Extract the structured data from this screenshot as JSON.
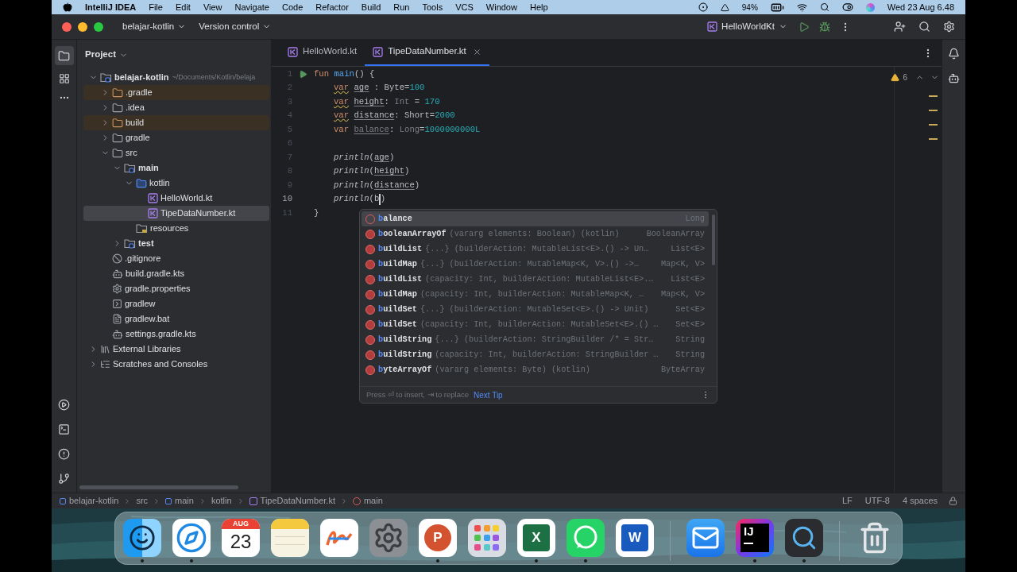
{
  "menubar": {
    "app": "IntelliJ IDEA",
    "menus": [
      "File",
      "Edit",
      "View",
      "Navigate",
      "Code",
      "Refactor",
      "Build",
      "Run",
      "Tools",
      "VCS",
      "Window",
      "Help"
    ],
    "battery": "94%",
    "clock": "Wed 23 Aug 6.48"
  },
  "titlebar": {
    "project": "belajar-kotlin",
    "vcs": "Version control",
    "run_config": "HelloWorldKt"
  },
  "tabs": [
    {
      "label": "HelloWorld.kt",
      "selected": false
    },
    {
      "label": "TipeDataNumber.kt",
      "selected": true
    }
  ],
  "project": {
    "title": "Project",
    "tree": [
      {
        "label": "belajar-kotlin",
        "hint": "~/Documents/Kotlin/belaja",
        "kind": "module",
        "expanded": true,
        "selected": false,
        "children": [
          {
            "label": ".gradle",
            "kind": "excluded",
            "expanded": false,
            "selected": false
          },
          {
            "label": ".idea",
            "kind": "folder",
            "expanded": false,
            "selected": false
          },
          {
            "label": "build",
            "kind": "excluded",
            "expanded": false,
            "selected": false
          },
          {
            "label": "gradle",
            "kind": "folder",
            "expanded": false,
            "selected": false
          },
          {
            "label": "src",
            "kind": "folder",
            "expanded": true,
            "selected": false,
            "children": [
              {
                "label": "main",
                "kind": "source_set",
                "expanded": true,
                "selected": false,
                "children": [
                  {
                    "label": "kotlin",
                    "kind": "source_root",
                    "expanded": true,
                    "selected": false,
                    "children": [
                      {
                        "label": "HelloWorld.kt",
                        "kind": "kotlin_file",
                        "selected": false
                      },
                      {
                        "label": "TipeDataNumber.kt",
                        "kind": "kotlin_file",
                        "selected": true
                      }
                    ]
                  },
                  {
                    "label": "resources",
                    "kind": "resource_root",
                    "selected": false
                  }
                ]
              },
              {
                "label": "test",
                "kind": "source_set",
                "expanded": false,
                "selected": false
              }
            ]
          },
          {
            "label": ".gitignore",
            "kind": "ignore_file",
            "selected": false
          },
          {
            "label": "build.gradle.kts",
            "kind": "gradle_file",
            "selected": false
          },
          {
            "label": "gradle.properties",
            "kind": "properties_file",
            "selected": false
          },
          {
            "label": "gradlew",
            "kind": "shell_file",
            "selected": false
          },
          {
            "label": "gradlew.bat",
            "kind": "text_file",
            "selected": false
          },
          {
            "label": "settings.gradle.kts",
            "kind": "gradle_file",
            "selected": false
          }
        ]
      },
      {
        "label": "External Libraries",
        "kind": "libraries",
        "expanded": false,
        "selected": false
      },
      {
        "label": "Scratches and Consoles",
        "kind": "scratches",
        "expanded": false,
        "selected": false
      }
    ]
  },
  "editor": {
    "warnings": "6",
    "lines": [
      {
        "number": "1",
        "run": true,
        "current": false,
        "indented": false,
        "tokens": [
          {
            "text": "fun",
            "kind": "keyword"
          },
          {
            "text": "main",
            "kind": "function_decl",
            "space_before": true
          },
          {
            "text": "() {",
            "kind": "plain"
          }
        ]
      },
      {
        "number": "2",
        "run": false,
        "current": false,
        "indented": true,
        "tokens": [
          {
            "text": "var",
            "kind": "keyword_warn"
          },
          {
            "text": "age",
            "kind": "local",
            "space_before": true
          },
          {
            "text": " : ",
            "kind": "plain"
          },
          {
            "text": "Byte",
            "kind": "type"
          },
          {
            "text": "=",
            "kind": "plain"
          },
          {
            "text": "100",
            "kind": "number"
          }
        ]
      },
      {
        "number": "3",
        "run": false,
        "current": false,
        "indented": true,
        "tokens": [
          {
            "text": "var",
            "kind": "keyword_warn"
          },
          {
            "text": "height",
            "kind": "local",
            "space_before": true
          },
          {
            "text": ": ",
            "kind": "plain"
          },
          {
            "text": "Int",
            "kind": "type_dim"
          },
          {
            "text": " = ",
            "kind": "plain"
          },
          {
            "text": "170",
            "kind": "number"
          }
        ]
      },
      {
        "number": "4",
        "run": false,
        "current": false,
        "indented": true,
        "tokens": [
          {
            "text": "var",
            "kind": "keyword_warn"
          },
          {
            "text": "distance",
            "kind": "local",
            "space_before": true
          },
          {
            "text": ": ",
            "kind": "plain"
          },
          {
            "text": "Short",
            "kind": "type"
          },
          {
            "text": "=",
            "kind": "plain"
          },
          {
            "text": "2000",
            "kind": "number"
          }
        ]
      },
      {
        "number": "5",
        "run": false,
        "current": false,
        "indented": true,
        "tokens": [
          {
            "text": "var",
            "kind": "keyword"
          },
          {
            "text": "balance",
            "kind": "local_unused",
            "space_before": true
          },
          {
            "text": ": ",
            "kind": "plain"
          },
          {
            "text": "Long",
            "kind": "type_dim"
          },
          {
            "text": "=",
            "kind": "plain"
          },
          {
            "text": "1000000000L",
            "kind": "number"
          }
        ]
      },
      {
        "number": "6",
        "run": false,
        "current": false
      },
      {
        "number": "7",
        "run": false,
        "current": false,
        "indented": true,
        "tokens": [
          {
            "text": "println",
            "kind": "call"
          },
          {
            "text": "(",
            "kind": "plain"
          },
          {
            "text": "age",
            "kind": "local"
          },
          {
            "text": ")",
            "kind": "plain"
          }
        ]
      },
      {
        "number": "8",
        "run": false,
        "current": false,
        "indented": true,
        "tokens": [
          {
            "text": "println",
            "kind": "call"
          },
          {
            "text": "(",
            "kind": "plain"
          },
          {
            "text": "height",
            "kind": "local"
          },
          {
            "text": ")",
            "kind": "plain"
          }
        ]
      },
      {
        "number": "9",
        "run": false,
        "current": false,
        "indented": true,
        "tokens": [
          {
            "text": "println",
            "kind": "call"
          },
          {
            "text": "(",
            "kind": "plain"
          },
          {
            "text": "distance",
            "kind": "local"
          },
          {
            "text": ")",
            "kind": "plain"
          }
        ]
      },
      {
        "number": "10",
        "run": false,
        "current": true,
        "indented": true,
        "tokens": [
          {
            "text": "println",
            "kind": "call"
          },
          {
            "text": "(",
            "kind": "plain"
          },
          {
            "text": "b",
            "kind": "plain"
          },
          {
            "kind": "caret"
          },
          {
            "text": ")",
            "kind": "plain"
          }
        ]
      },
      {
        "number": "11",
        "run": false,
        "current": false,
        "indented": false,
        "tokens": [
          {
            "text": "}",
            "kind": "plain"
          }
        ]
      }
    ],
    "completion": {
      "items": [
        {
          "kind": "variable",
          "match": "b",
          "rest": "alance",
          "type": "Long",
          "selected": true
        },
        {
          "kind": "function",
          "match": "b",
          "rest": "ooleanArrayOf",
          "signature": "(vararg elements: Boolean) (kotlin)",
          "type": "BooleanArray",
          "selected": false
        },
        {
          "kind": "function",
          "match": "b",
          "rest": "uildList",
          "signature": "{...} (builderAction: MutableList<E>.() -> Un…",
          "type": "List<E>",
          "selected": false
        },
        {
          "kind": "function",
          "match": "b",
          "rest": "uildMap",
          "signature": "{...} (builderAction: MutableMap<K, V>.() ->…",
          "type": "Map<K, V>",
          "selected": false
        },
        {
          "kind": "function",
          "match": "b",
          "rest": "uildList",
          "signature": "(capacity: Int, builderAction: MutableList<E>.…",
          "type": "List<E>",
          "selected": false
        },
        {
          "kind": "function",
          "match": "b",
          "rest": "uildMap",
          "signature": "(capacity: Int, builderAction: MutableMap<K, …",
          "type": "Map<K, V>",
          "selected": false
        },
        {
          "kind": "function",
          "match": "b",
          "rest": "uildSet",
          "signature": "{...} (builderAction: MutableSet<E>.() -> Unit)",
          "type": "Set<E>",
          "selected": false
        },
        {
          "kind": "function",
          "match": "b",
          "rest": "uildSet",
          "signature": "(capacity: Int, builderAction: MutableSet<E>.() …",
          "type": "Set<E>",
          "selected": false
        },
        {
          "kind": "function",
          "match": "b",
          "rest": "uildString",
          "signature": "{...} (builderAction: StringBuilder /* = Str…",
          "type": "String",
          "selected": false
        },
        {
          "kind": "function",
          "match": "b",
          "rest": "uildString",
          "signature": "(capacity: Int, builderAction: StringBuilder …",
          "type": "String",
          "selected": false
        },
        {
          "kind": "function",
          "match": "b",
          "rest": "yteArrayOf",
          "signature": "(vararg elements: Byte) (kotlin)",
          "type": "ByteArray",
          "selected": false
        }
      ],
      "hint": "Press ⏎ to insert, ⇥ to replace",
      "tip": "Next Tip"
    }
  },
  "status": {
    "breadcrumbs": [
      {
        "label": "belajar-kotlin",
        "kind": "module"
      },
      {
        "label": "src",
        "kind": "plain"
      },
      {
        "label": "main",
        "kind": "module"
      },
      {
        "label": "kotlin",
        "kind": "plain"
      },
      {
        "label": "TipeDataNumber.kt",
        "kind": "kotlin_file"
      },
      {
        "label": "main",
        "kind": "function"
      }
    ],
    "line_separator": "LF",
    "encoding": "UTF-8",
    "indent": "4 spaces"
  },
  "dock": [
    {
      "kind": "finder",
      "running": true
    },
    {
      "kind": "safari",
      "running": true
    },
    {
      "kind": "calendar",
      "month": "AUG",
      "day": "23",
      "running": false
    },
    {
      "kind": "notes",
      "running": false
    },
    {
      "kind": "freeform",
      "running": false
    },
    {
      "kind": "settings",
      "running": false
    },
    {
      "kind": "powerpoint",
      "letter": "P",
      "running": true
    },
    {
      "kind": "launchpad",
      "running": false
    },
    {
      "kind": "excel",
      "letter": "X",
      "running": true
    },
    {
      "kind": "whatsapp",
      "running": true
    },
    {
      "kind": "word",
      "letter": "W",
      "running": false
    },
    {
      "kind": "separator"
    },
    {
      "kind": "mail",
      "running": false
    },
    {
      "kind": "intellij",
      "letter": "IJ",
      "running": true
    },
    {
      "kind": "quicktime",
      "running": true
    },
    {
      "kind": "separator"
    },
    {
      "kind": "trash",
      "running": false
    }
  ]
}
